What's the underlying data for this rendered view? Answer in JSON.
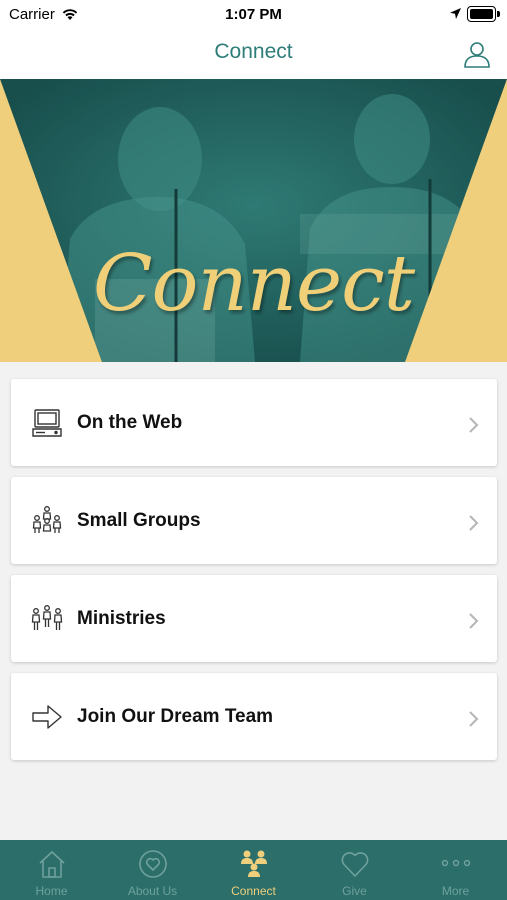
{
  "status_bar": {
    "carrier": "Carrier",
    "time": "1:07 PM",
    "wifi_icon": "wifi-icon",
    "location_icon": "location-arrow-icon",
    "battery_icon": "battery-icon"
  },
  "nav": {
    "title": "Connect",
    "profile_icon": "user-profile-icon"
  },
  "hero": {
    "text": "Connect",
    "colors": {
      "accent": "#f0cf7c",
      "tint": "#1f6461"
    }
  },
  "list": [
    {
      "label": "On the Web",
      "icon": "computer-icon"
    },
    {
      "label": "Small Groups",
      "icon": "small-groups-icon"
    },
    {
      "label": "Ministries",
      "icon": "ministries-icon"
    },
    {
      "label": "Join Our Dream Team",
      "icon": "arrow-right-icon"
    }
  ],
  "tabs": [
    {
      "label": "Home",
      "icon": "home-icon",
      "active": false
    },
    {
      "label": "About Us",
      "icon": "heart-circle-icon",
      "active": false
    },
    {
      "label": "Connect",
      "icon": "connect-people-icon",
      "active": true
    },
    {
      "label": "Give",
      "icon": "heart-icon",
      "active": false
    },
    {
      "label": "More",
      "icon": "more-dots-icon",
      "active": false
    }
  ],
  "colors": {
    "brand": "#2e7d78",
    "tab_bar": "#2b6e6a",
    "tab_active": "#f0cf7c",
    "tab_inactive": "#6fa19d",
    "background": "#f2f2f2"
  }
}
